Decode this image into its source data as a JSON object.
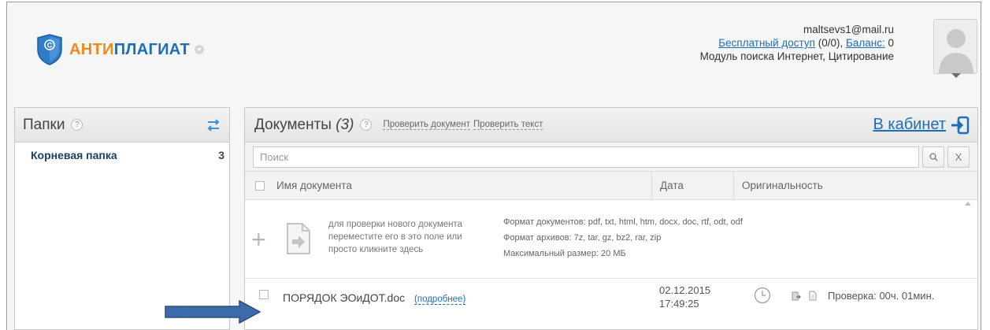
{
  "brand": {
    "name_part1": "АНТИ",
    "name_part2": "ПЛАГИАТ",
    "colors": {
      "orange": "#f08a1c",
      "blue": "#1d6fb5"
    }
  },
  "account": {
    "email": "maltsevs1@mail.ru",
    "free_access_label": "Бесплатный доступ",
    "free_access_value": "(0/0),",
    "balance_label": "Баланс:",
    "balance_value": "0",
    "modules": "Модуль поиска Интернет, Цитирование"
  },
  "folders": {
    "title": "Папки",
    "help": "?",
    "items": [
      {
        "label": "Корневая папка",
        "count": "3"
      }
    ]
  },
  "documents": {
    "title": "Документы",
    "count": "(3)",
    "help": "?",
    "check_document_link": "Проверить документ",
    "check_text_link": "Проверить текст",
    "cabinet_link": "В кабинет",
    "search_placeholder": "Поиск",
    "clear_button": "X",
    "columns": {
      "name": "Имя документа",
      "date": "Дата",
      "originality": "Оригинальность"
    },
    "drop_zone": {
      "line1": "для проверки нового документа",
      "line2": "переместите его в это поле или",
      "line3": "просто кликните здесь",
      "formats_docs": "Формат документов: pdf, txt, html, htm, docx, doc, rtf, odt, odf",
      "formats_archives": "Формат архивов: 7z, tar, gz, bz2, rar, zip",
      "max_size": "Максимальный размер: 20 МБ"
    },
    "rows": [
      {
        "name": "ПОРЯДОК ЭОиДОТ.doc",
        "more": "(подробнее)",
        "date": "02.12.2015",
        "time": "17:49:25",
        "status": "Проверка: 00ч. 01мин."
      }
    ]
  }
}
